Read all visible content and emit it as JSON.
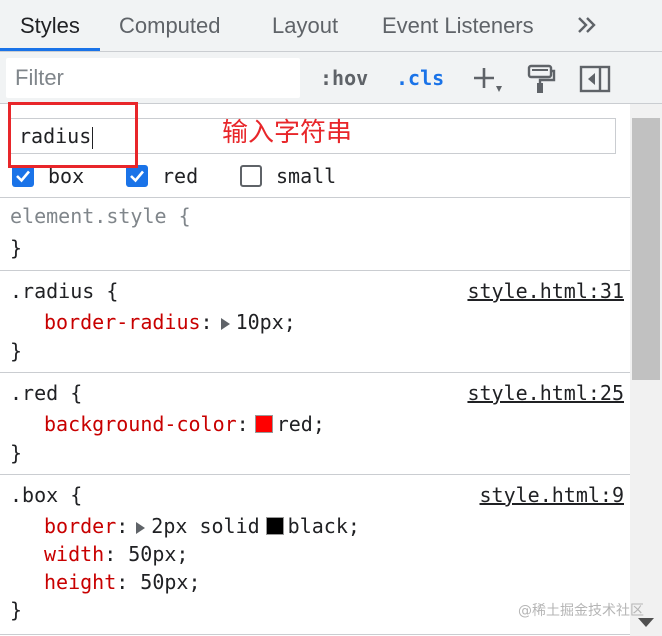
{
  "tabs": [
    {
      "label": "Styles",
      "active": true
    },
    {
      "label": "Computed",
      "active": false
    },
    {
      "label": "Layout",
      "active": false
    },
    {
      "label": "Event Listeners",
      "active": false
    }
  ],
  "more_tabs_icon": "double-chevron-right-icon",
  "toolbar": {
    "filter_placeholder": "Filter",
    "hov_label": ":hov",
    "cls_label": ".cls",
    "icons": [
      "plus-icon",
      "paint-brush-icon",
      "toggle-sidebar-icon"
    ]
  },
  "class_panel": {
    "input_value": "radius",
    "classes": [
      {
        "name": "box",
        "checked": true
      },
      {
        "name": "red",
        "checked": true
      },
      {
        "name": "small",
        "checked": false
      }
    ]
  },
  "annotation": {
    "text": "输入字符串",
    "color": "#e8262a"
  },
  "rules": [
    {
      "selector": "element.style {",
      "source": "",
      "declarations": [],
      "close": "}"
    },
    {
      "selector": ".radius {",
      "source": "style.html:31",
      "declarations": [
        {
          "prop": "border-radius",
          "colon": ":",
          "expandable": true,
          "value": "10px;"
        }
      ],
      "close": "}"
    },
    {
      "selector": ".red {",
      "source": "style.html:25",
      "declarations": [
        {
          "prop": "background-color",
          "colon": ":",
          "swatch": "#ff0000",
          "value": "red;"
        }
      ],
      "close": "}"
    },
    {
      "selector": ".box {",
      "source": "style.html:9",
      "declarations": [
        {
          "prop": "border",
          "colon": ":",
          "expandable": true,
          "value": "2px solid",
          "swatch": "#000000",
          "value2": "black;"
        },
        {
          "prop": "width",
          "colon": ":",
          "value": "50px;"
        },
        {
          "prop": "height",
          "colon": ":",
          "value": "50px;"
        }
      ],
      "close": "}"
    }
  ],
  "watermark": "@稀土掘金技术社区",
  "colors": {
    "accent": "#1a73e8",
    "property": "#c80000",
    "annotation": "#e8262a"
  }
}
